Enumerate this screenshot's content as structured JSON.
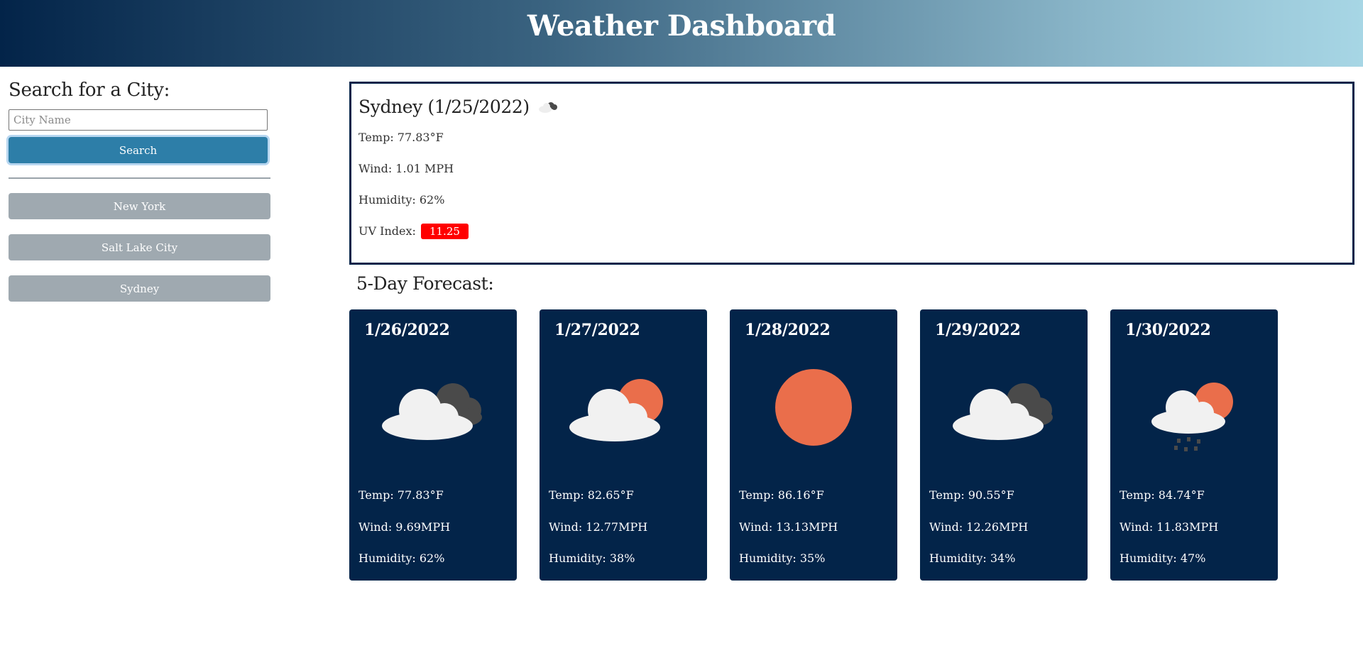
{
  "header": {
    "title": "Weather Dashboard"
  },
  "search": {
    "heading": "Search for a City:",
    "placeholder": "City Name",
    "button_label": "Search"
  },
  "history": [
    {
      "label": "New York"
    },
    {
      "label": "Salt Lake City"
    },
    {
      "label": "Sydney"
    }
  ],
  "current": {
    "title": "Sydney (1/25/2022)",
    "icon": "broken-clouds-icon",
    "temp": "Temp: 77.83°F",
    "wind": "Wind: 1.01 MPH",
    "humidity": "Humidity: 62%",
    "uv_label": "UV Index:",
    "uv_value": "11.25",
    "uv_color": "#ff0000"
  },
  "forecast": {
    "heading": "5-Day Forecast:",
    "days": [
      {
        "date": "1/26/2022",
        "icon": "broken-clouds-icon",
        "temp": "Temp: 77.83°F",
        "wind": "Wind: 9.69MPH",
        "humidity": "Humidity: 62%"
      },
      {
        "date": "1/27/2022",
        "icon": "partly-cloudy-icon",
        "temp": "Temp: 82.65°F",
        "wind": "Wind: 12.77MPH",
        "humidity": "Humidity: 38%"
      },
      {
        "date": "1/28/2022",
        "icon": "clear-sun-icon",
        "temp": "Temp: 86.16°F",
        "wind": "Wind: 13.13MPH",
        "humidity": "Humidity: 35%"
      },
      {
        "date": "1/29/2022",
        "icon": "broken-clouds-icon",
        "temp": "Temp: 90.55°F",
        "wind": "Wind: 12.26MPH",
        "humidity": "Humidity: 34%"
      },
      {
        "date": "1/30/2022",
        "icon": "rain-sun-icon",
        "temp": "Temp: 84.74°F",
        "wind": "Wind: 11.83MPH",
        "humidity": "Humidity: 47%"
      }
    ]
  },
  "colors": {
    "header_dark": "#032449",
    "header_light": "#a7d6e5",
    "search_button": "#2d7ea8",
    "history_button": "#9fa9b0",
    "card_bg": "#032449",
    "sun": "#ea6e4b",
    "cloud": "#f1f1f1",
    "dark_cloud": "#4a4a4a"
  }
}
